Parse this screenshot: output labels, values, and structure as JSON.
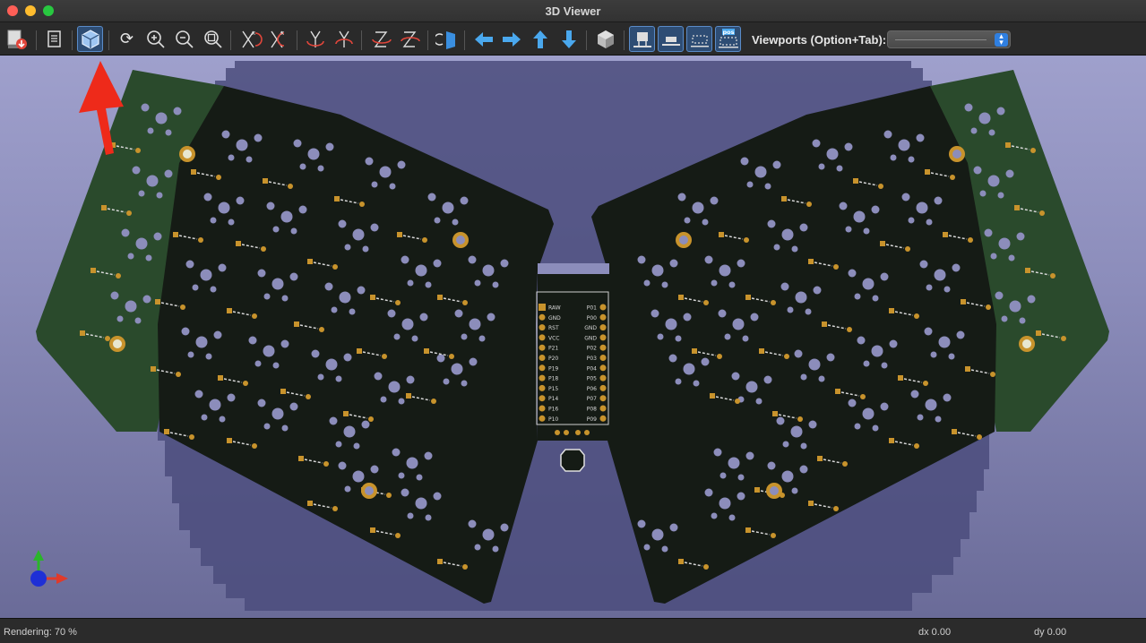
{
  "window": {
    "title": "3D Viewer"
  },
  "toolbar": {
    "viewports_label": "Viewports (Option+Tab):",
    "viewports_selected": "",
    "pos_badge": "pos",
    "buttons": [
      {
        "name": "export-image-icon"
      },
      {
        "name": "copy-icon"
      },
      {
        "name": "3d-cube-icon",
        "active": true
      },
      {
        "name": "reload-icon"
      },
      {
        "name": "zoom-in-icon"
      },
      {
        "name": "zoom-out-icon"
      },
      {
        "name": "zoom-fit-icon"
      },
      {
        "name": "rotate-x-cw-icon"
      },
      {
        "name": "rotate-x-ccw-icon"
      },
      {
        "name": "rotate-y-cw-icon"
      },
      {
        "name": "rotate-y-ccw-icon"
      },
      {
        "name": "rotate-z-cw-icon"
      },
      {
        "name": "rotate-z-ccw-icon"
      },
      {
        "name": "flip-board-icon"
      },
      {
        "name": "pan-left-icon"
      },
      {
        "name": "pan-right-icon"
      },
      {
        "name": "pan-up-icon"
      },
      {
        "name": "pan-down-icon"
      },
      {
        "name": "ortho-cube-icon"
      },
      {
        "name": "show-tht-icon"
      },
      {
        "name": "show-smd-icon"
      },
      {
        "name": "show-virtual-icon"
      },
      {
        "name": "show-not-in-pos-icon"
      }
    ]
  },
  "viewport": {
    "controller_pins_left": [
      "RAW",
      "GND",
      "RST",
      "VCC",
      "P21",
      "P20",
      "P19",
      "P18",
      "P15",
      "P14",
      "P16",
      "P10"
    ],
    "controller_pins_right": [
      "P01",
      "P00",
      "GND",
      "GND",
      "P02",
      "P03",
      "P04",
      "P05",
      "P06",
      "P07",
      "P08",
      "P09"
    ]
  },
  "status": {
    "rendering": "Rendering: 70 %",
    "dx": "dx 0.00",
    "dy": "dy 0.00"
  },
  "colors": {
    "accent": "#4aa8ee",
    "pcb_dark": "#141a14",
    "pcb_green": "#27422a",
    "pad_gold": "#c8932c",
    "annotation_arrow": "#ee2a1a"
  }
}
